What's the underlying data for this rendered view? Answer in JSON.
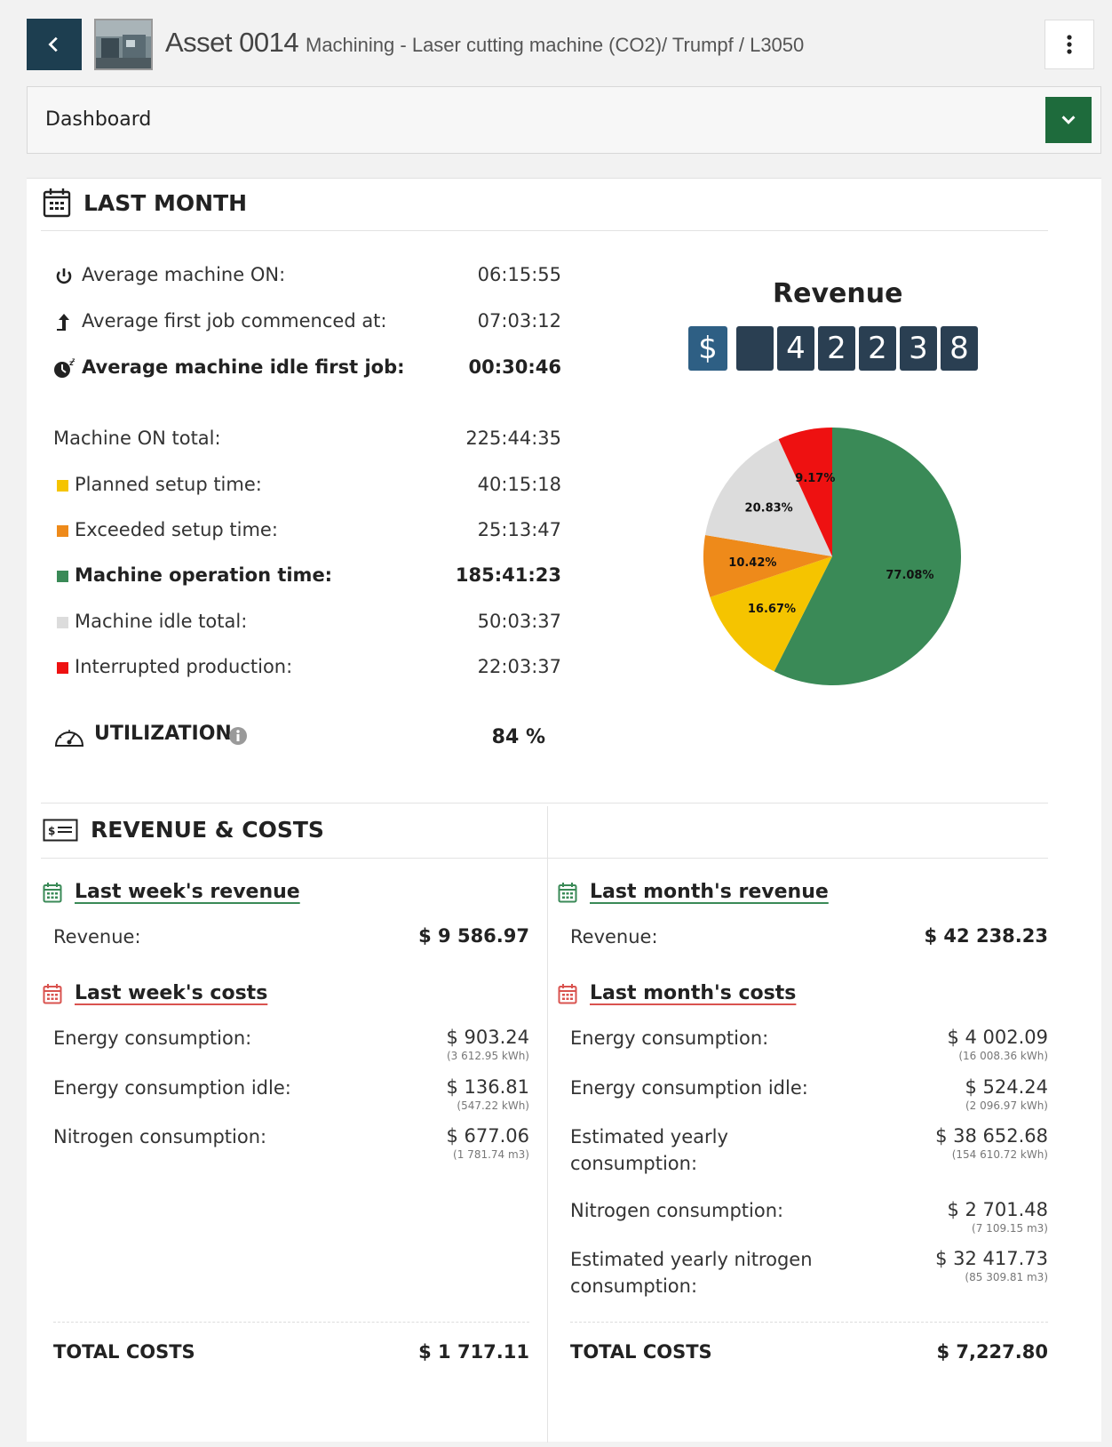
{
  "header": {
    "asset_name": "Asset 0014",
    "asset_subtitle": "Machining - Laser cutting machine (CO2)/ Trumpf / L3050"
  },
  "dropdown": {
    "label": "Dashboard"
  },
  "last_month": {
    "title": "LAST MONTH",
    "stats": [
      {
        "label": "Average machine ON:",
        "value": "06:15:55"
      },
      {
        "label": "Average first job commenced at:",
        "value": "07:03:12"
      },
      {
        "label": "Average machine idle first job:",
        "value": "00:30:46"
      }
    ],
    "machine_on_total": {
      "label": "Machine ON total:",
      "value": "225:44:35"
    },
    "breakdown": [
      {
        "label": "Planned setup time:",
        "value": "40:15:18",
        "color": "#f5c400"
      },
      {
        "label": "Exceeded setup time:",
        "value": "25:13:47",
        "color": "#ee8a1a"
      },
      {
        "label": "Machine operation time:",
        "value": "185:41:23",
        "color": "#3a8a57"
      },
      {
        "label": "Machine idle total:",
        "value": "50:03:37",
        "color": "#dcdcdc"
      },
      {
        "label": "Interrupted production:",
        "value": "22:03:37",
        "color": "#ee1111"
      }
    ],
    "utilization": {
      "label": "UTILIZATION",
      "value": "84 %"
    }
  },
  "revenue_counter": {
    "title": "Revenue",
    "currency": "$",
    "digits": [
      "",
      "4",
      "2",
      "2",
      "3",
      "8"
    ]
  },
  "chart_data": {
    "type": "pie",
    "slices": [
      {
        "label": "77.08%",
        "value": 77.08,
        "color": "#3a8a57"
      },
      {
        "label": "16.67%",
        "value": 16.67,
        "color": "#f5c400"
      },
      {
        "label": "10.42%",
        "value": 10.42,
        "color": "#ee8a1a"
      },
      {
        "label": "20.83%",
        "value": 20.83,
        "color": "#dcdcdc"
      },
      {
        "label": "9.17%",
        "value": 9.17,
        "color": "#ee1111"
      }
    ]
  },
  "revenue_costs": {
    "title": "REVENUE  & COSTS",
    "week": {
      "revenue_title": "Last week's revenue",
      "revenue_label": "Revenue:",
      "revenue_value": "$ 9 586.97",
      "costs_title": "Last week's costs",
      "costs": [
        {
          "label": "Energy consumption:",
          "value": "$ 903.24",
          "sub": "(3 612.95 kWh)"
        },
        {
          "label": "Energy consumption idle:",
          "value": "$ 136.81",
          "sub": "(547.22 kWh)"
        },
        {
          "label": "Nitrogen consumption:",
          "value": "$ 677.06",
          "sub": "(1 781.74 m3)"
        }
      ],
      "total_label": "TOTAL COSTS",
      "total_value": "$ 1 717.11"
    },
    "month": {
      "revenue_title": "Last month's revenue",
      "revenue_label": "Revenue:",
      "revenue_value": "$ 42 238.23",
      "costs_title": "Last month's costs",
      "costs": [
        {
          "label": "Energy consumption:",
          "value": "$ 4 002.09",
          "sub": "(16 008.36 kWh)"
        },
        {
          "label": "Energy consumption idle:",
          "value": "$ 524.24",
          "sub": "(2 096.97 kWh)"
        },
        {
          "label_1": "Estimated yearly",
          "label_2": "consumption:",
          "value": "$ 38 652.68",
          "sub": "(154 610.72 kWh)"
        },
        {
          "label": "Nitrogen consumption:",
          "value": "$ 2 701.48",
          "sub": "(7 109.15 m3)"
        },
        {
          "label_1": "Estimated yearly nitrogen",
          "label_2": "consumption:",
          "value": "$ 32 417.73",
          "sub": "(85 309.81 m3)"
        }
      ],
      "total_label": "TOTAL COSTS",
      "total_value": "$ 7,227.80"
    }
  }
}
